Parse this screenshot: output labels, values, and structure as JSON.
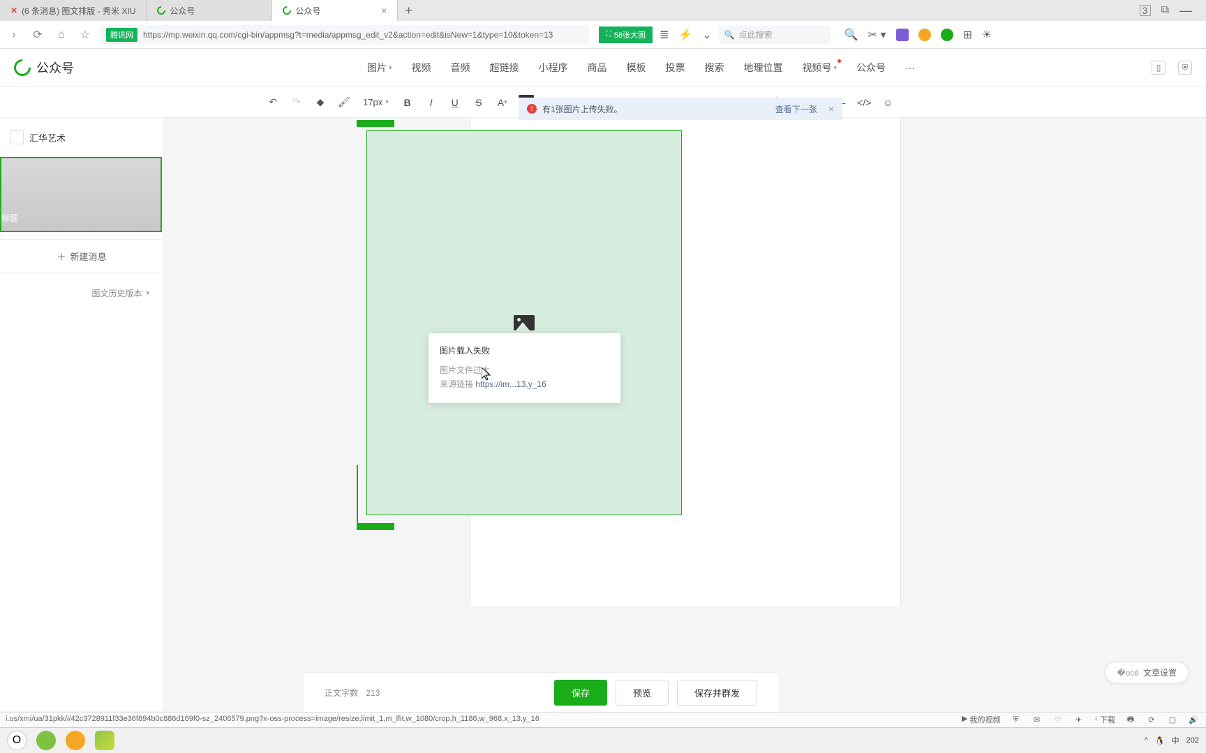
{
  "tabs": [
    {
      "label": "(6 条消息) 图文排版 - 秀米 XIU"
    },
    {
      "label": "公众号"
    },
    {
      "label": "公众号",
      "active": true
    }
  ],
  "browser": {
    "site_label": "腾讯网",
    "url": "https://mp.weixin.qq.com/cgi-bin/appmsg?t=media/appmsg_edit_v2&action=edit&isNew=1&type=10&token=13",
    "badge": "58张大图",
    "search_placeholder": "点此搜索",
    "counter": "3"
  },
  "app": {
    "name": "公众号",
    "insert_menu": [
      "图片",
      "视频",
      "音频",
      "超链接",
      "小程序",
      "商品",
      "模板",
      "投票",
      "搜索",
      "地理位置",
      "视频号",
      "公众号"
    ]
  },
  "toolbar": {
    "font_size": "17px"
  },
  "sidebar": {
    "account": "汇华艺术",
    "card_title": "标题",
    "new_msg": "新建消息",
    "history": "图文历史版本"
  },
  "notice": {
    "text": "有1张图片上传失败。",
    "action": "查看下一张"
  },
  "tooltip": {
    "title": "图片载入失败",
    "reason": "图片文件过大",
    "source_label": "来源链接",
    "source_url": "https://im...13,y_16"
  },
  "footer": {
    "word_count_label": "正文字数",
    "word_count": "213",
    "save": "保存",
    "preview": "预览",
    "save_send": "保存并群发"
  },
  "article_settings": "文章设置",
  "status_url": "i.us/xmi/ua/31pkk/i/42c3728911f33e36f894b0c886d169f0-sz_2406579.png?x-oss-process=image/resize,limit_1,m_lfit,w_1080/crop,h_1186,w_968,x_13,y_16",
  "status_right": {
    "video": "我的视频",
    "download": "下载"
  },
  "taskbar": {
    "ime": "中",
    "year": "202"
  }
}
